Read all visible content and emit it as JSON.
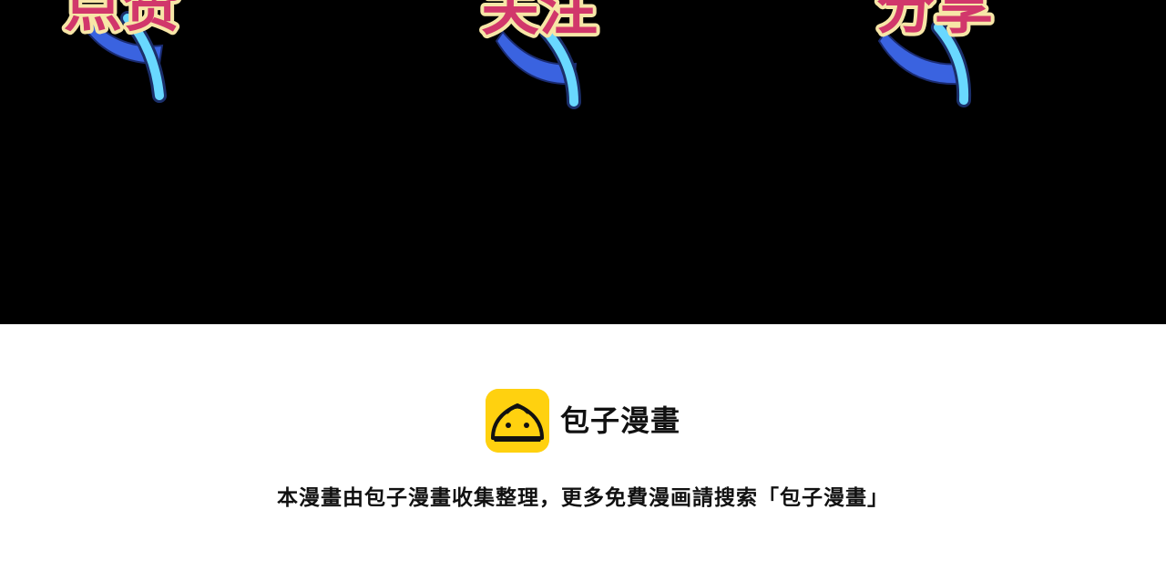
{
  "comic_panel": {
    "background": "#000000",
    "sfx": [
      "点赞",
      "关注",
      "分享"
    ],
    "sfx_colors": {
      "fill": "#d1376b",
      "outline": "#f7e6a7",
      "swoosh_blue": "#3a63e0",
      "swoosh_cyan": "#69d8ff"
    }
  },
  "footer": {
    "brand": {
      "name": "包子漫畫",
      "logo_icon": "baozi-bun-icon",
      "logo_color": "#ffd10f"
    },
    "notice": "本漫畫由包子漫畫收集整理，更多免費漫画請搜索「包子漫畫」"
  }
}
